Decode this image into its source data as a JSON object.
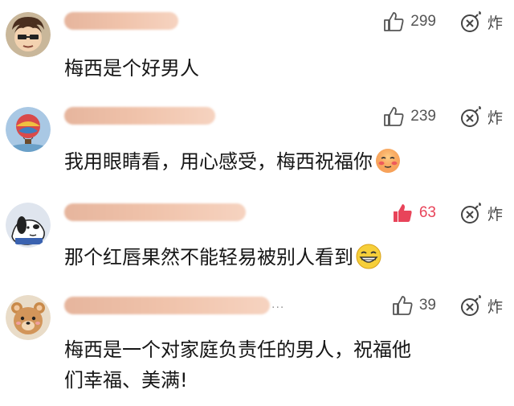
{
  "comments": [
    {
      "text": "梅西是个好男人",
      "like_count": "299",
      "liked": false,
      "bomb_label": "炸"
    },
    {
      "text": "我用眼睛看，用心感受，梅西祝福你",
      "like_count": "239",
      "liked": false,
      "bomb_label": "炸",
      "emoji": "blushing-face-icon"
    },
    {
      "text": "那个红唇果然不能轻易被别人看到",
      "like_count": "63",
      "liked": true,
      "bomb_label": "炸",
      "emoji": "grinning-face-icon"
    },
    {
      "text_line1": "梅西是一个对家庭负责任的男人，祝福他",
      "text_line2": "们幸福、美满!",
      "like_count": "39",
      "liked": false,
      "bomb_label": "炸",
      "username_suffix": "..."
    }
  ],
  "colors": {
    "like_active": "#e8445a",
    "icon_gray": "#555555",
    "username_blur": "#eebfa6"
  }
}
